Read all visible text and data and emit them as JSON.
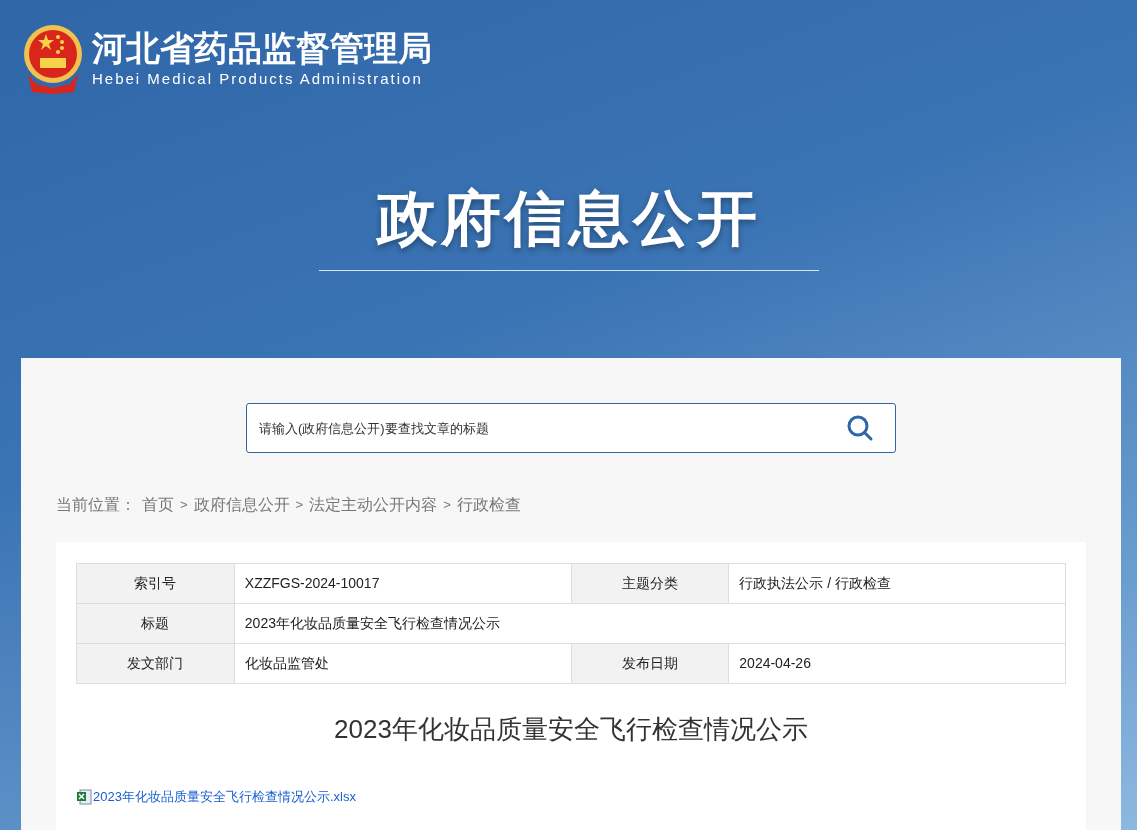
{
  "header": {
    "site_name": "河北省药品监督管理局",
    "site_name_en": "Hebei Medical Products Administration",
    "section_title": "政府信息公开"
  },
  "search": {
    "placeholder": "请输入(政府信息公开)要查找文章的标题"
  },
  "breadcrumb": {
    "label": "当前位置：",
    "separator": ">",
    "items": [
      "首页",
      "政府信息公开",
      "法定主动公开内容",
      "行政检查"
    ]
  },
  "meta_table": {
    "rows": [
      {
        "cells": [
          {
            "label": "索引号",
            "value": "XZZFGS-2024-10017"
          },
          {
            "label": "主题分类",
            "value": "行政执法公示 / 行政检查"
          }
        ]
      },
      {
        "cells": [
          {
            "label": "标题",
            "value": "2023年化妆品质量安全飞行检查情况公示"
          }
        ]
      },
      {
        "cells": [
          {
            "label": "发文部门",
            "value": "化妆品监管处"
          },
          {
            "label": "发布日期",
            "value": "2024-04-26"
          }
        ]
      }
    ]
  },
  "article": {
    "title": "2023年化妆品质量安全飞行检查情况公示",
    "attachments": [
      {
        "kind": "xlsx",
        "name": "2023年化妆品质量安全飞行检查情况公示.xlsx"
      }
    ]
  }
}
